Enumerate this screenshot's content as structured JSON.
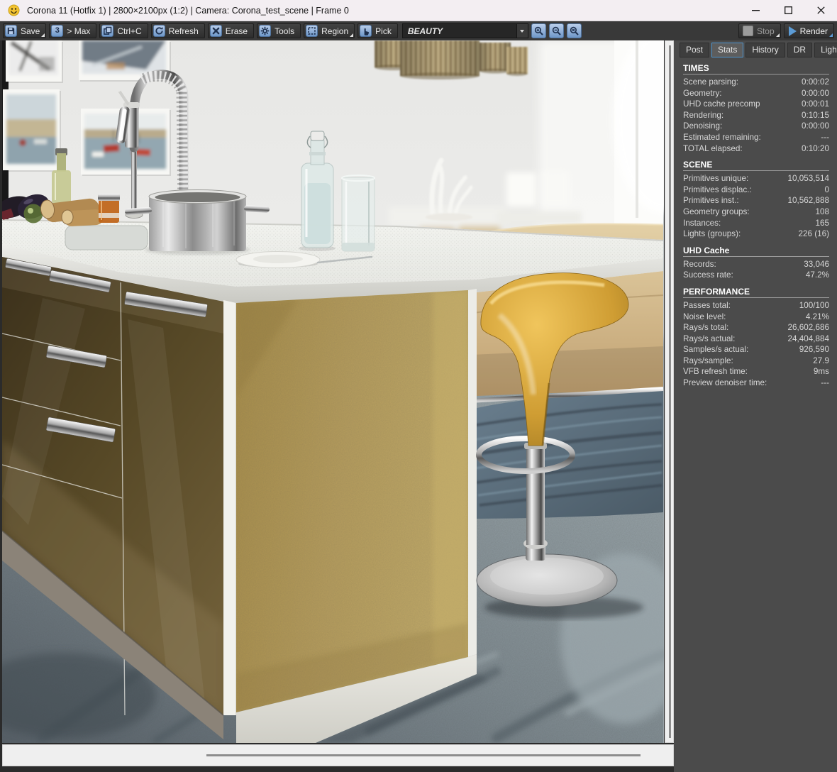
{
  "titlebar": {
    "title": "Corona 11 (Hotfix 1) | 2800×2100px (1:2) | Camera: Corona_test_scene | Frame 0"
  },
  "toolbar": {
    "buttons": [
      {
        "label": "Save",
        "icon": "save-icon",
        "has_menu": true
      },
      {
        "label": "> Max",
        "icon": "max-icon",
        "has_menu": false,
        "icon_text": "3"
      },
      {
        "label": "Ctrl+C",
        "icon": "copy-icon",
        "has_menu": false
      },
      {
        "label": "Refresh",
        "icon": "refresh-icon",
        "has_menu": false
      },
      {
        "label": "Erase",
        "icon": "erase-icon",
        "has_menu": false
      },
      {
        "label": "Tools",
        "icon": "tools-icon",
        "has_menu": false
      },
      {
        "label": "Region",
        "icon": "region-icon",
        "has_menu": true
      },
      {
        "label": "Pick",
        "icon": "pick-icon",
        "has_menu": false
      }
    ],
    "channel_value": "BEAUTY",
    "stop_label": "Stop",
    "render_label": "Render"
  },
  "tabs": [
    {
      "label": "Post",
      "active": false
    },
    {
      "label": "Stats",
      "active": true
    },
    {
      "label": "History",
      "active": false
    },
    {
      "label": "DR",
      "active": false
    },
    {
      "label": "LightMix",
      "active": false
    }
  ],
  "stats": {
    "sections": [
      {
        "title": "TIMES",
        "rows": [
          [
            "Scene parsing:",
            "0:00:02"
          ],
          [
            "Geometry:",
            "0:00:00"
          ],
          [
            "UHD cache precomp",
            "0:00:01"
          ],
          [
            "Rendering:",
            "0:10:15"
          ],
          [
            "Denoising:",
            "0:00:00"
          ],
          [
            "Estimated remaining:",
            "---"
          ],
          [
            "TOTAL elapsed:",
            "0:10:20"
          ]
        ]
      },
      {
        "title": "SCENE",
        "rows": [
          [
            "Primitives unique:",
            "10,053,514"
          ],
          [
            "Primitives displac.:",
            "0"
          ],
          [
            "Primitives inst.:",
            "10,562,888"
          ],
          [
            "Geometry groups:",
            "108"
          ],
          [
            "Instances:",
            "165"
          ],
          [
            "Lights (groups):",
            "226 (16)"
          ]
        ]
      },
      {
        "title": "UHD Cache",
        "rows": [
          [
            "Records:",
            "33,046"
          ],
          [
            "Success rate:",
            "47.2%"
          ]
        ]
      },
      {
        "title": "PERFORMANCE",
        "rows": [
          [
            "Passes total:",
            "100/100"
          ],
          [
            "Noise level:",
            "4.21%"
          ],
          [
            "Rays/s total:",
            "26,602,686"
          ],
          [
            "Rays/s actual:",
            "24,404,884"
          ],
          [
            "Samples/s actual:",
            "926,590"
          ],
          [
            "Rays/sample:",
            "27.9"
          ],
          [
            "VFB refresh time:",
            "9ms"
          ],
          [
            "Preview denoiser time:",
            "---"
          ]
        ]
      }
    ]
  },
  "colors": {
    "titlebar_bg": "#f3eef2",
    "toolbar_bg": "#393939",
    "panel_bg": "#4b4b4b",
    "accent_blue": "#5b9bd5",
    "icon_blue": "#a9c4e4",
    "tab_active_border": "#4f94cd",
    "scrollbar_bg": "#efefef",
    "counter_white": "#eef0ec",
    "cabinet_gold": "#b59c5c",
    "cabinet_olive": "#564826",
    "stool_gold": "#cf9d33",
    "sofa_beige": "#cfb285",
    "rug_slate": "#5c7180",
    "floor_concrete": "#7f8b91"
  }
}
